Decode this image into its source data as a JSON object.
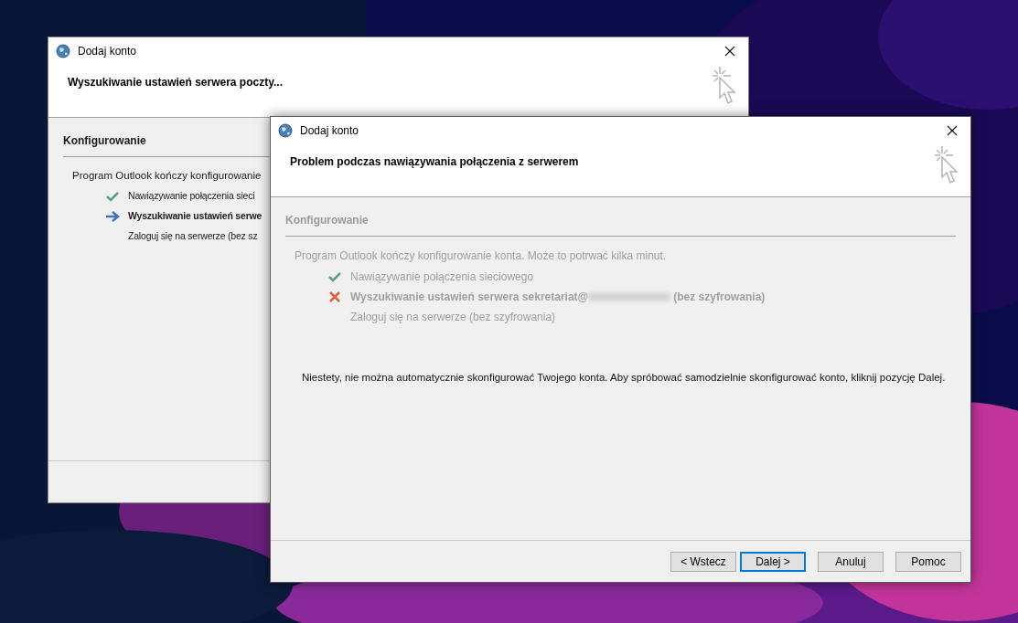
{
  "windows": [
    {
      "title": "Dodaj konto",
      "heading": "Wyszukiwanie ustawień serwera poczty...",
      "section": "Konfigurowanie",
      "disabled": false,
      "intro": "Program Outlook kończy konfigurowanie",
      "steps": [
        {
          "kind": "done",
          "label": "Nawiązywanie połączenia sieci"
        },
        {
          "kind": "current",
          "label": "Wyszukiwanie ustawień serwe"
        },
        {
          "kind": "pending",
          "label": "Zaloguj się na serwerze (bez sz"
        }
      ]
    },
    {
      "title": "Dodaj konto",
      "heading": "Problem podczas nawiązywania połączenia z serwerem",
      "section": "Konfigurowanie",
      "disabled": true,
      "intro": "Program Outlook kończy konfigurowanie konta. Może to potrwać kilka minut.",
      "steps": [
        {
          "kind": "done",
          "label": "Nawiązywanie połączenia sieciowego"
        },
        {
          "kind": "failed",
          "label": "Wyszukiwanie ustawień serwera sekretariat@",
          "redacted": true,
          "suffix": "(bez szyfrowania)"
        },
        {
          "kind": "pending",
          "label": "Zaloguj się na serwerze (bez szyfrowania)"
        }
      ],
      "message": "Niestety, nie można automatycznie skonfigurować Twojego konta. Aby spróbować samodzielnie skonfigurować konto, kliknij pozycję Dalej.",
      "buttons": [
        {
          "label": "< Wstecz",
          "default": false
        },
        {
          "label": "Dalej >",
          "default": true
        },
        {
          "label": "Anuluj",
          "default": false
        },
        {
          "label": "Pomoc",
          "default": false
        }
      ]
    }
  ]
}
